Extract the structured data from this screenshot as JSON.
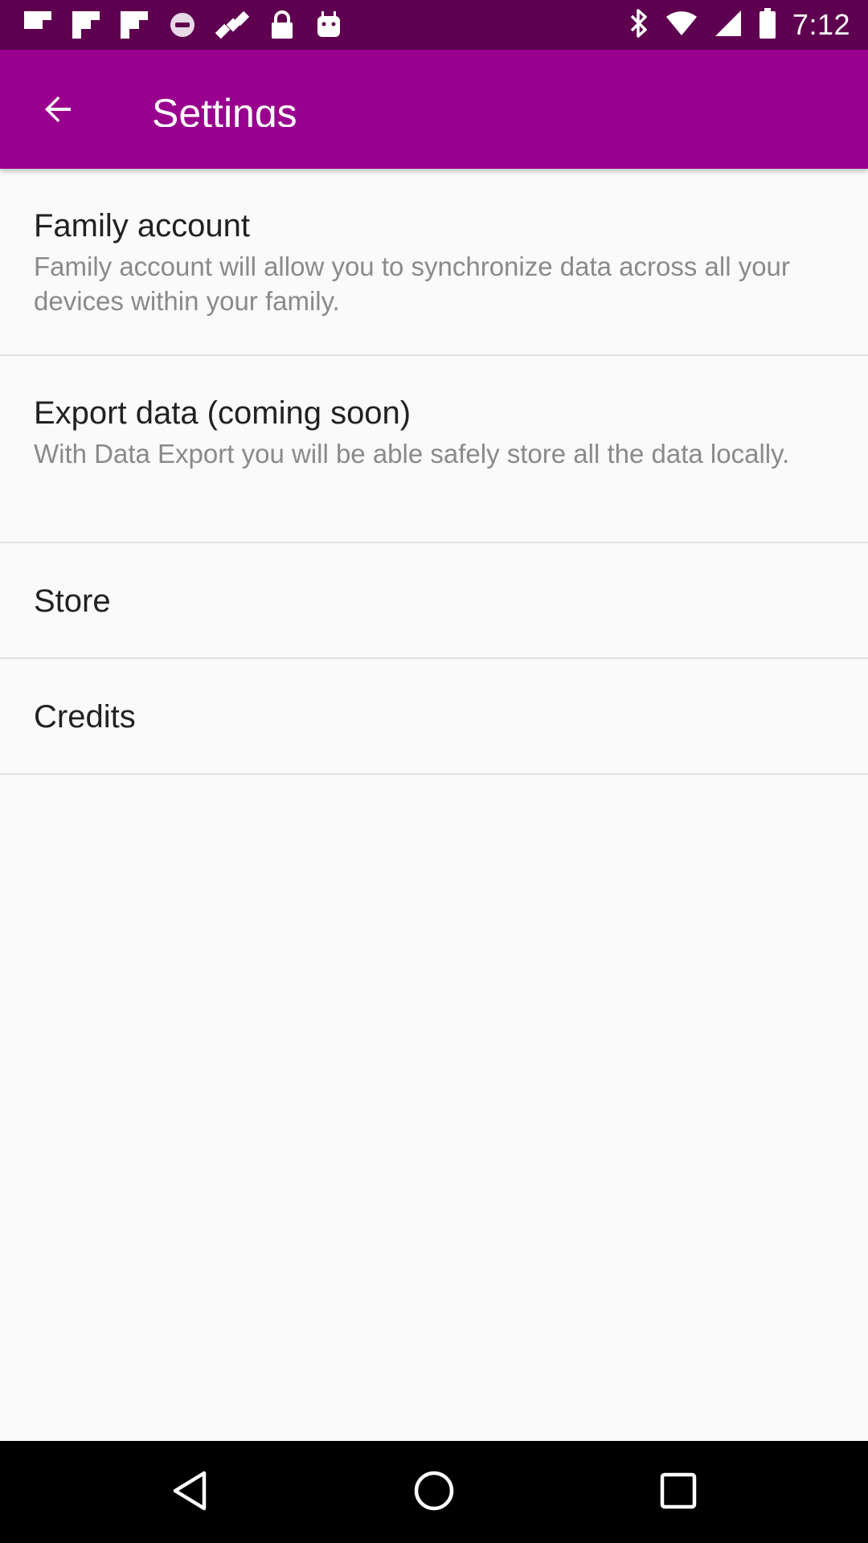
{
  "status_bar": {
    "time": "7:12",
    "icons": [
      "flipboard-icon",
      "flipboard-icon",
      "flipboard-icon",
      "circle-icon",
      "satellite-fake-gps-icon",
      "lock-icon",
      "android-icon",
      "bluetooth-icon",
      "wifi-icon",
      "signal-icon",
      "battery-icon"
    ],
    "background": "#5e004f"
  },
  "app_bar": {
    "title": "Settings",
    "back_icon": "arrow-back-icon",
    "background": "#98008d"
  },
  "settings": [
    {
      "title": "Family account",
      "summary": "Family account will allow you to synchronize data across all your devices within your family."
    },
    {
      "title": "Export data (coming soon)",
      "summary": "With Data Export you will be able safely store all the data locally."
    },
    {
      "title": "Store"
    },
    {
      "title": "Credits"
    }
  ],
  "nav_bar": {
    "icons": [
      "back-triangle-icon",
      "home-circle-icon",
      "recents-square-icon"
    ]
  }
}
